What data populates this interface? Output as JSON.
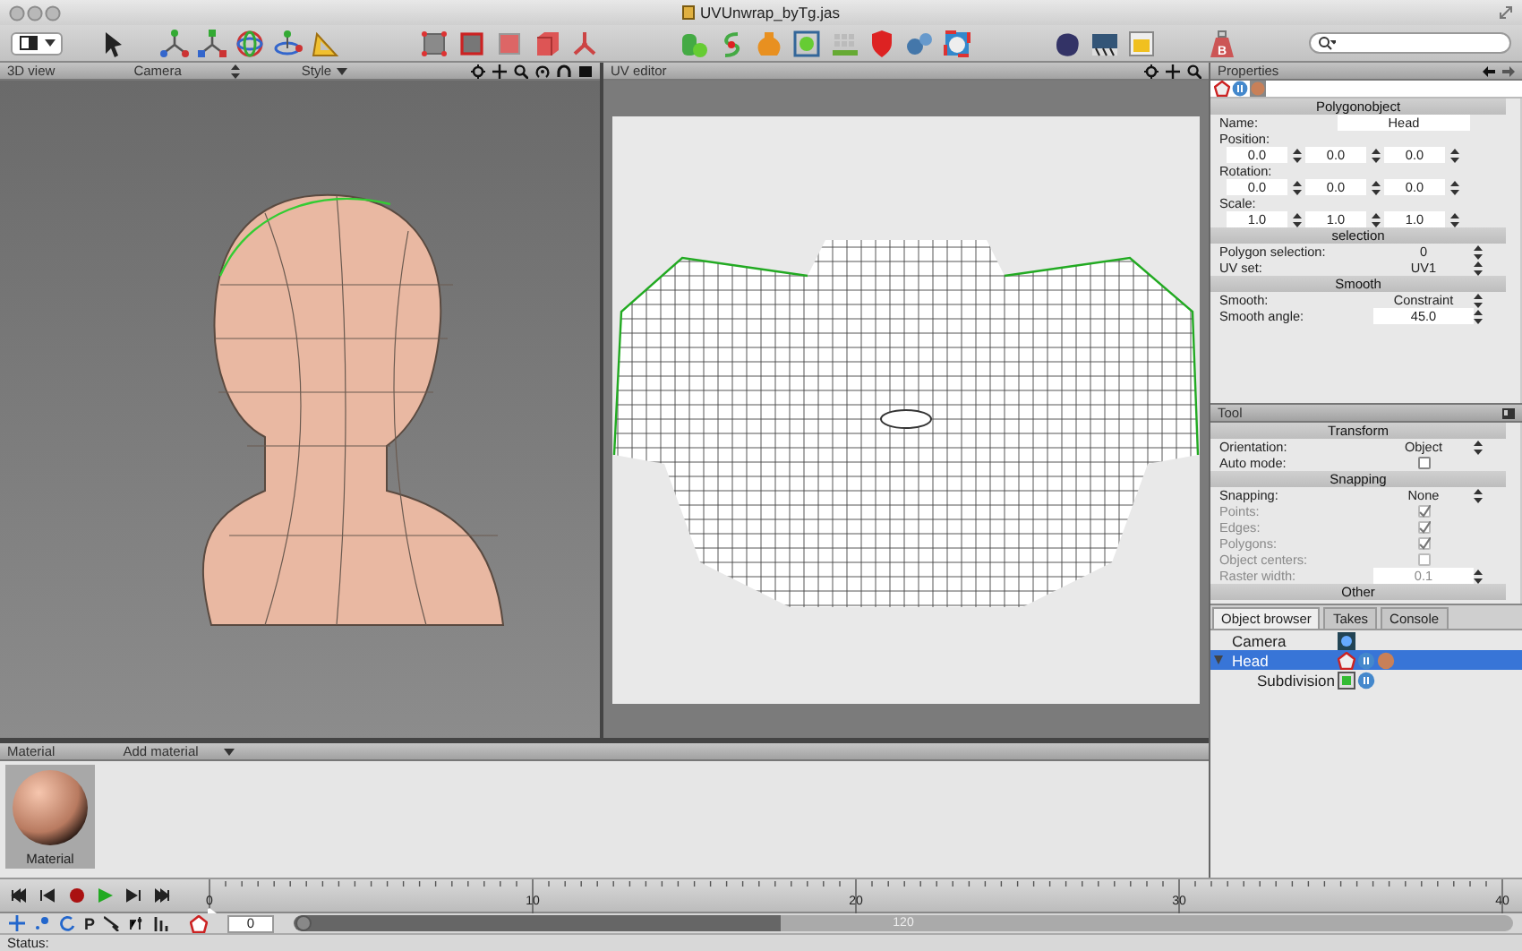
{
  "window": {
    "title": "UVUnwrap_byTg.jas"
  },
  "toolbar": {
    "bake_label": "B"
  },
  "view_3d": {
    "title": "3D view",
    "menus": [
      "Camera",
      "Style"
    ]
  },
  "uv_editor": {
    "title": "UV editor"
  },
  "properties": {
    "title": "Properties",
    "sections": [
      {
        "title": "Polygonobject",
        "rows": [
          {
            "kind": "text",
            "label": "Name:",
            "value": "Head"
          },
          {
            "kind": "vector",
            "label": "Position:",
            "values": [
              "0.0",
              "0.0",
              "0.0"
            ]
          },
          {
            "kind": "vector",
            "label": "Rotation:",
            "values": [
              "0.0",
              "0.0",
              "0.0"
            ]
          },
          {
            "kind": "vector",
            "label": "Scale:",
            "values": [
              "1.0",
              "1.0",
              "1.0"
            ]
          }
        ]
      },
      {
        "title": "selection",
        "rows": [
          {
            "kind": "select",
            "label": "Polygon selection:",
            "value": "0"
          },
          {
            "kind": "select",
            "label": "UV set:",
            "value": "UV1"
          }
        ]
      },
      {
        "title": "Smooth",
        "rows": [
          {
            "kind": "select",
            "label": "Smooth:",
            "value": "Constraint"
          },
          {
            "kind": "number",
            "label": "Smooth angle:",
            "value": "45.0"
          }
        ]
      }
    ]
  },
  "tool": {
    "title": "Tool",
    "sections": [
      {
        "title": "Transform",
        "rows": [
          {
            "kind": "select",
            "label": "Orientation:",
            "value": "Object"
          },
          {
            "kind": "checkbox",
            "label": "Auto mode:",
            "checked": false,
            "disabled": false
          }
        ]
      },
      {
        "title": "Snapping",
        "rows": [
          {
            "kind": "select",
            "label": "Snapping:",
            "value": "None"
          },
          {
            "kind": "checkbox",
            "label": "Points:",
            "checked": true,
            "disabled": true
          },
          {
            "kind": "checkbox",
            "label": "Edges:",
            "checked": true,
            "disabled": true
          },
          {
            "kind": "checkbox",
            "label": "Polygons:",
            "checked": true,
            "disabled": true
          },
          {
            "kind": "checkbox",
            "label": "Object centers:",
            "checked": false,
            "disabled": true
          },
          {
            "kind": "number",
            "label": "Raster width:",
            "value": "0.1",
            "disabled": true
          }
        ]
      },
      {
        "title": "Other"
      }
    ]
  },
  "object_browser": {
    "tabs": [
      {
        "label": "Object browser",
        "selected": true
      },
      {
        "label": "Takes",
        "selected": false
      },
      {
        "label": "Console",
        "selected": false
      }
    ],
    "items": [
      {
        "name": "Camera",
        "selected": false
      },
      {
        "name": "Head",
        "selected": true,
        "expanded": true,
        "children": [
          {
            "name": "Subdivision",
            "selected": false
          }
        ]
      }
    ]
  },
  "material": {
    "title": "Material",
    "menu": "Add material",
    "items": [
      {
        "name": "Material",
        "selected": true
      }
    ]
  },
  "timeline": {
    "labels": [
      "0",
      "10",
      "20",
      "30",
      "40"
    ],
    "frame": "0",
    "tool_letter": "P",
    "range": {
      "label": "120",
      "level": 0.4
    }
  },
  "status_bar": {
    "text": "Status:"
  }
}
